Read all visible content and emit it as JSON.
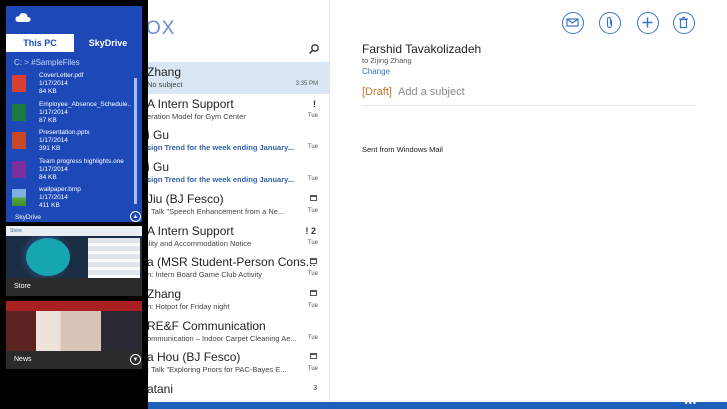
{
  "colors": {
    "onedrive_blue": "#1d49b8",
    "mail_accent": "#3874c8",
    "draft_orange": "#c4772a",
    "selected_row": "#dbe6f5"
  },
  "onedrive": {
    "tabs": [
      "This PC",
      "SkyDrive"
    ],
    "path": "C: >   #SampleFiles",
    "files": [
      {
        "name": "CoverLetter.pdf",
        "date": "1/17/2014",
        "size": "84 KB",
        "icon": "pdf-icon"
      },
      {
        "name": "Employee_Absence_Schedule...",
        "date": "1/17/2014",
        "size": "87 KB",
        "icon": "excel-icon"
      },
      {
        "name": "Presentation.pptx",
        "date": "1/17/2014",
        "size": "391 KB",
        "icon": "powerpoint-icon"
      },
      {
        "name": "Team progress highlights.one",
        "date": "1/17/2014",
        "size": "84 KB",
        "icon": "onenote-icon"
      },
      {
        "name": "wallpaper.bmp",
        "date": "1/17/2014",
        "size": "411 KB",
        "icon": "image-icon"
      }
    ],
    "footer_label": "SkyDrive"
  },
  "thumbs": {
    "store_label": "Store",
    "news_label": "News",
    "store_head": "Store"
  },
  "mail": {
    "list_title": "OX",
    "messages": [
      {
        "sender": "Zhang",
        "subject": "No subject",
        "time": "3:35 PM",
        "marker": "",
        "bold": false,
        "selected": true
      },
      {
        "sender": "A Intern Support",
        "subject": "eration Model for Gym Center",
        "time": "Tue",
        "marker": "!",
        "bold": false
      },
      {
        "sender": "i Gu",
        "subject": "sign Trend for the week ending January...",
        "time": "Tue",
        "marker": "",
        "bold": true
      },
      {
        "sender": "i Gu",
        "subject": "sign Trend for the week ending January...",
        "time": "Tue",
        "marker": "",
        "bold": true
      },
      {
        "sender": "Jiu (BJ Fesco)",
        "subject": ": Talk \"Speech Enhancement from a Ne...",
        "time": "Tue",
        "marker": "cal",
        "bold": false
      },
      {
        "sender": "A Intern Support",
        "subject": "ility and Accommodation Notice",
        "time": "Tue",
        "marker": "! 2",
        "bold": false
      },
      {
        "sender": "a (MSR Student-Person Cons...",
        "subject": "n: Intern Board Game Club Activity",
        "time": "Tue",
        "marker": "cal",
        "bold": false
      },
      {
        "sender": "Zhang",
        "subject": "n: Hotpot for Friday night",
        "time": "Tue",
        "marker": "cal",
        "bold": false
      },
      {
        "sender": "RE&F Communication",
        "subject": "ommunication – Indoor Carpet Cleaning Ae...",
        "time": "Tue",
        "marker": "",
        "bold": false
      },
      {
        "sender": "a Hou (BJ Fesco)",
        "subject": ": Talk \"Exploring Priors for PAC-Bayes E...",
        "time": "Tue",
        "marker": "cal",
        "bold": false
      },
      {
        "sender": "atani",
        "subject": "",
        "time": "",
        "marker": "3",
        "bold": false
      }
    ],
    "reading": {
      "from": "Farshid Tavakolizadeh",
      "to": "to Zijing Zhang",
      "change": "Change",
      "draft": "[Draft]",
      "subject_placeholder": "Add a subject",
      "body": "Sent from Windows Mail"
    },
    "commands": [
      "send-icon",
      "attach-icon",
      "new-icon",
      "delete-icon"
    ],
    "bottom_more": "•••"
  }
}
